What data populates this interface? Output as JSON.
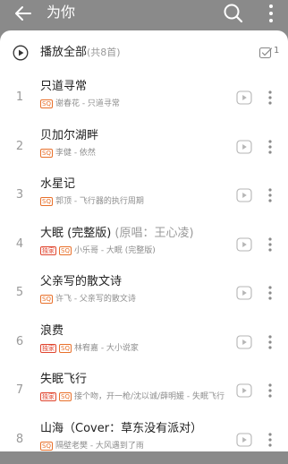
{
  "header": {
    "title": "为你",
    "icons": [
      "back-arrow-icon",
      "search-icon",
      "more-vertical-icon"
    ]
  },
  "play_all": {
    "label": "播放全部",
    "count_text": "(共8首)",
    "multi_select_count": "1"
  },
  "songs": [
    {
      "index": "1",
      "title": "只道寻常",
      "note": "",
      "badges": [
        "SQ"
      ],
      "subtitle": "谢春花 - 只道寻常"
    },
    {
      "index": "2",
      "title": "贝加尔湖畔",
      "note": "",
      "badges": [
        "SQ"
      ],
      "subtitle": "李健 - 依然"
    },
    {
      "index": "3",
      "title": "水星记",
      "note": "",
      "badges": [
        "SQ"
      ],
      "subtitle": "郭顶 - 飞行器的执行周期"
    },
    {
      "index": "4",
      "title": "大眠 (完整版)",
      "note": " (原唱：王心凌)",
      "badges": [
        "独家",
        "SQ"
      ],
      "subtitle": "小乐哥 - 大眠 (完整版)"
    },
    {
      "index": "5",
      "title": "父亲写的散文诗",
      "note": "",
      "badges": [
        "SQ"
      ],
      "subtitle": "许飞 - 父亲写的散文诗"
    },
    {
      "index": "6",
      "title": "浪费",
      "note": "",
      "badges": [
        "独家",
        "SQ"
      ],
      "subtitle": "林宥嘉 - 大小说家"
    },
    {
      "index": "7",
      "title": "失眠飞行",
      "note": "",
      "badges": [
        "独家",
        "SQ"
      ],
      "subtitle": "接个吻，开一枪/沈以诚/薛明媛 - 失眠飞行"
    },
    {
      "index": "8",
      "title": "山海（Cover：草东没有派对）",
      "note": "",
      "badges": [
        "SQ"
      ],
      "subtitle": "隔壁老樊 - 大风遇到了雨"
    }
  ],
  "colors": {
    "overlay": "#8a8a8a",
    "sheet": "#ffffff",
    "badge": "#e8702a",
    "muted": "#9a9a9a"
  }
}
